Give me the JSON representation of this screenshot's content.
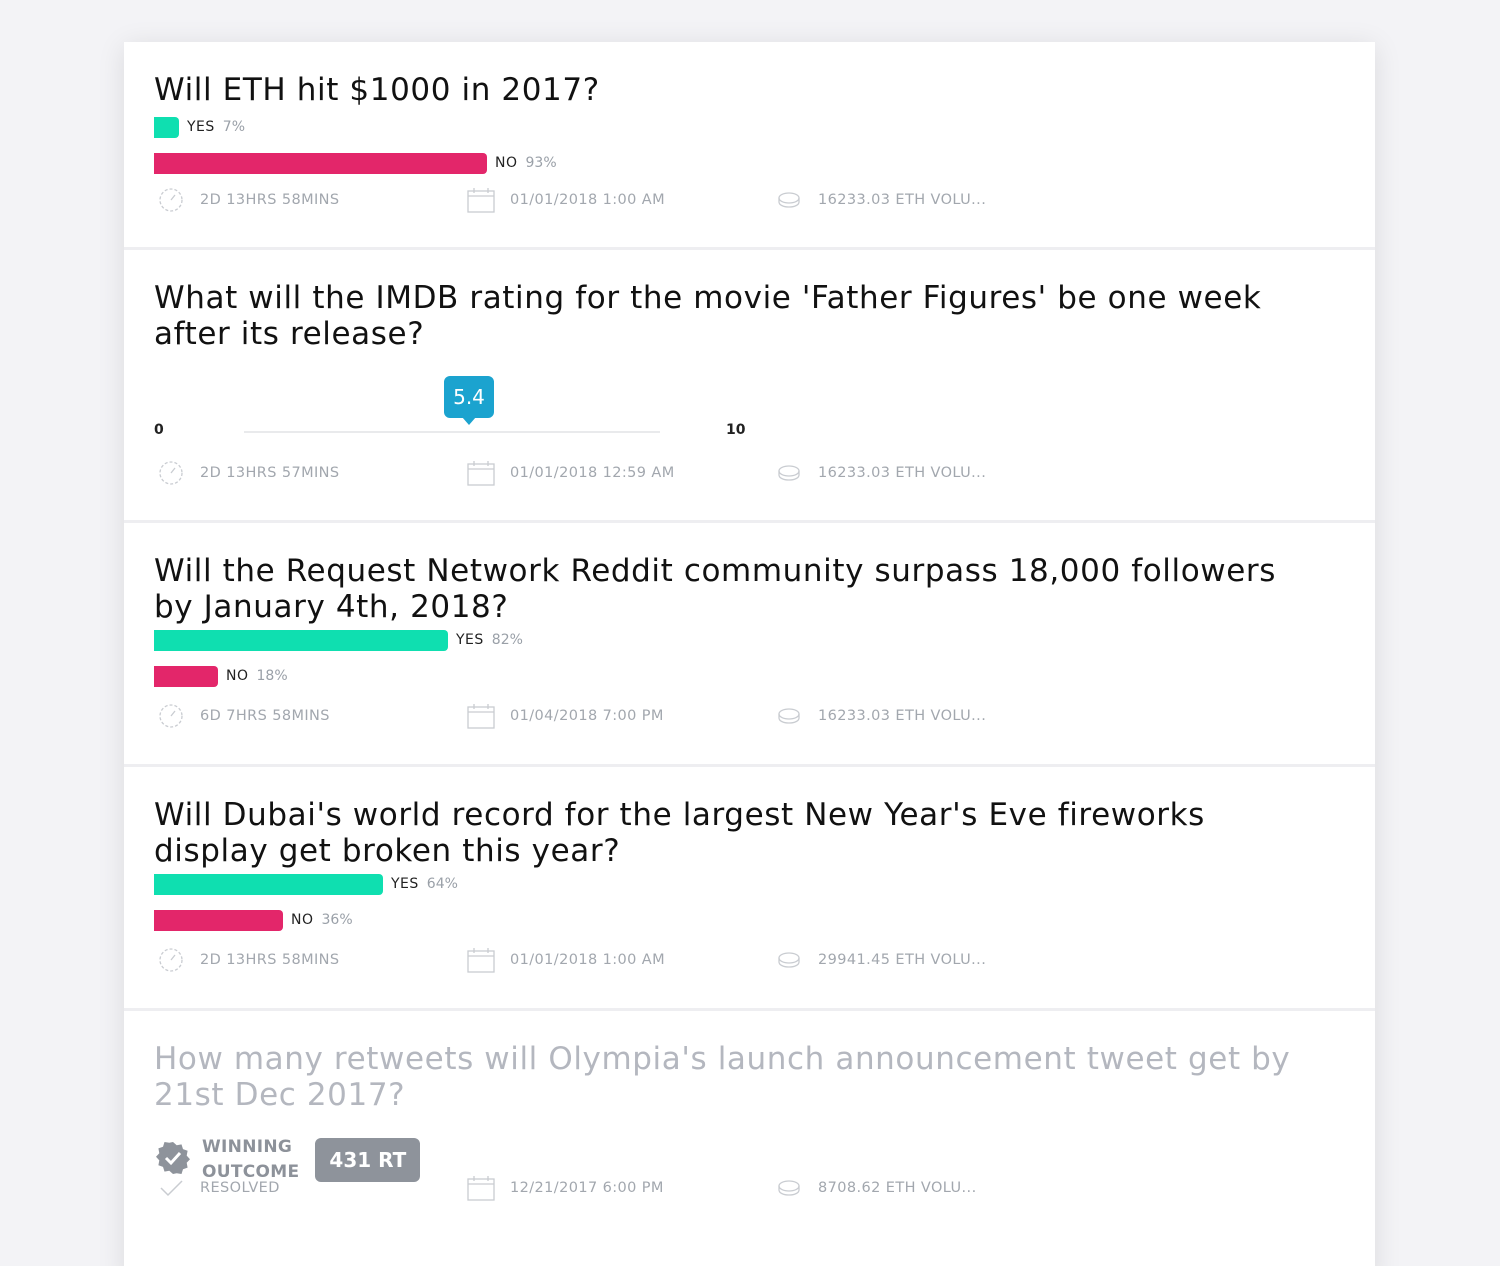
{
  "colors": {
    "yes": "#0fdfb0",
    "no": "#e3266a",
    "slider_bubble": "#1ba3cf",
    "muted": "#a2a7ae",
    "resolved_pill": "#8e939b"
  },
  "markets": [
    {
      "title": "Will ETH hit $1000 in 2017?",
      "outcomes": [
        {
          "label": "YES",
          "pct": "7%",
          "fraction": 0.07,
          "kind": "yes"
        },
        {
          "label": "NO",
          "pct": "93%",
          "fraction": 0.93,
          "kind": "no"
        }
      ],
      "time_left": "2D 13HRS 58MINS",
      "end_date": "01/01/2018 1:00 AM",
      "volume": "16233.03 ETH  VOLU..."
    },
    {
      "title": "What will the IMDB rating for the movie 'Father Figures' be one week after its release?",
      "slider": {
        "min": "0",
        "max": "10",
        "value": "5.4"
      },
      "time_left": "2D 13HRS 57MINS",
      "end_date": "01/01/2018 12:59 AM",
      "volume": "16233.03 ETH  VOLU..."
    },
    {
      "title": "Will the Request Network Reddit community surpass 18,000 followers by January 4th, 2018?",
      "outcomes": [
        {
          "label": "YES",
          "pct": "82%",
          "fraction": 0.82,
          "kind": "yes"
        },
        {
          "label": "NO",
          "pct": "18%",
          "fraction": 0.18,
          "kind": "no"
        }
      ],
      "time_left": "6D 7HRS 58MINS",
      "end_date": "01/04/2018 7:00 PM",
      "volume": "16233.03 ETH  VOLU..."
    },
    {
      "title": "Will Dubai's world record for the largest New Year's Eve fireworks display get broken this year?",
      "outcomes": [
        {
          "label": "YES",
          "pct": "64%",
          "fraction": 0.64,
          "kind": "yes"
        },
        {
          "label": "NO",
          "pct": "36%",
          "fraction": 0.36,
          "kind": "no"
        }
      ],
      "time_left": "2D 13HRS 58MINS",
      "end_date": "01/01/2018 1:00 AM",
      "volume": "29941.45 ETH  VOLU..."
    },
    {
      "title": "How many retweets will Olympia's launch announcement tweet get by 21st Dec 2017?",
      "winning": {
        "label_line1": "WINNING",
        "label_line2": "OUTCOME",
        "value": "431 RT"
      },
      "status": "RESOLVED",
      "end_date": "12/21/2017 6:00 PM",
      "volume": "8708.62 ETH  VOLU..."
    }
  ]
}
